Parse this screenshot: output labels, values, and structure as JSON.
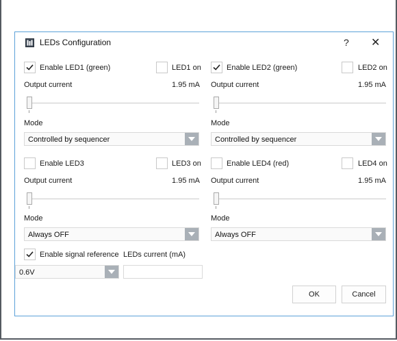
{
  "dialog": {
    "title": "LEDs Configuration",
    "help_label": "?",
    "close_label": "✕"
  },
  "leds": [
    {
      "enable_label": "Enable LED1 (green)",
      "enabled": true,
      "on_label": "LED1 on",
      "on_checked": false,
      "current_label": "Output current",
      "current_value": "1.95 mA",
      "slider_fraction": 0.0,
      "mode_label": "Mode",
      "mode_value": "Controlled by sequencer"
    },
    {
      "enable_label": "Enable LED2 (green)",
      "enabled": true,
      "on_label": "LED2 on",
      "on_checked": false,
      "current_label": "Output current",
      "current_value": "1.95 mA",
      "slider_fraction": 0.0,
      "mode_label": "Mode",
      "mode_value": "Controlled by sequencer"
    },
    {
      "enable_label": "Enable LED3",
      "enabled": false,
      "on_label": "LED3 on",
      "on_checked": false,
      "current_label": "Output current",
      "current_value": "1.95 mA",
      "slider_fraction": 0.0,
      "mode_label": "Mode",
      "mode_value": "Always OFF"
    },
    {
      "enable_label": "Enable LED4 (red)",
      "enabled": false,
      "on_label": "LED4 on",
      "on_checked": false,
      "current_label": "Output current",
      "current_value": "1.95 mA",
      "slider_fraction": 0.0,
      "mode_label": "Mode",
      "mode_value": "Always OFF"
    }
  ],
  "signal_reference": {
    "enable_label": "Enable signal reference",
    "enabled": true,
    "value": "0.6V"
  },
  "leds_current": {
    "label": "LEDs current (mA)",
    "value": ""
  },
  "buttons": {
    "ok_label": "OK",
    "cancel_label": "Cancel"
  },
  "colors": {
    "dialog_border": "#5aa0d8",
    "dropdown_arrow_bg": "#a9b0b7"
  }
}
